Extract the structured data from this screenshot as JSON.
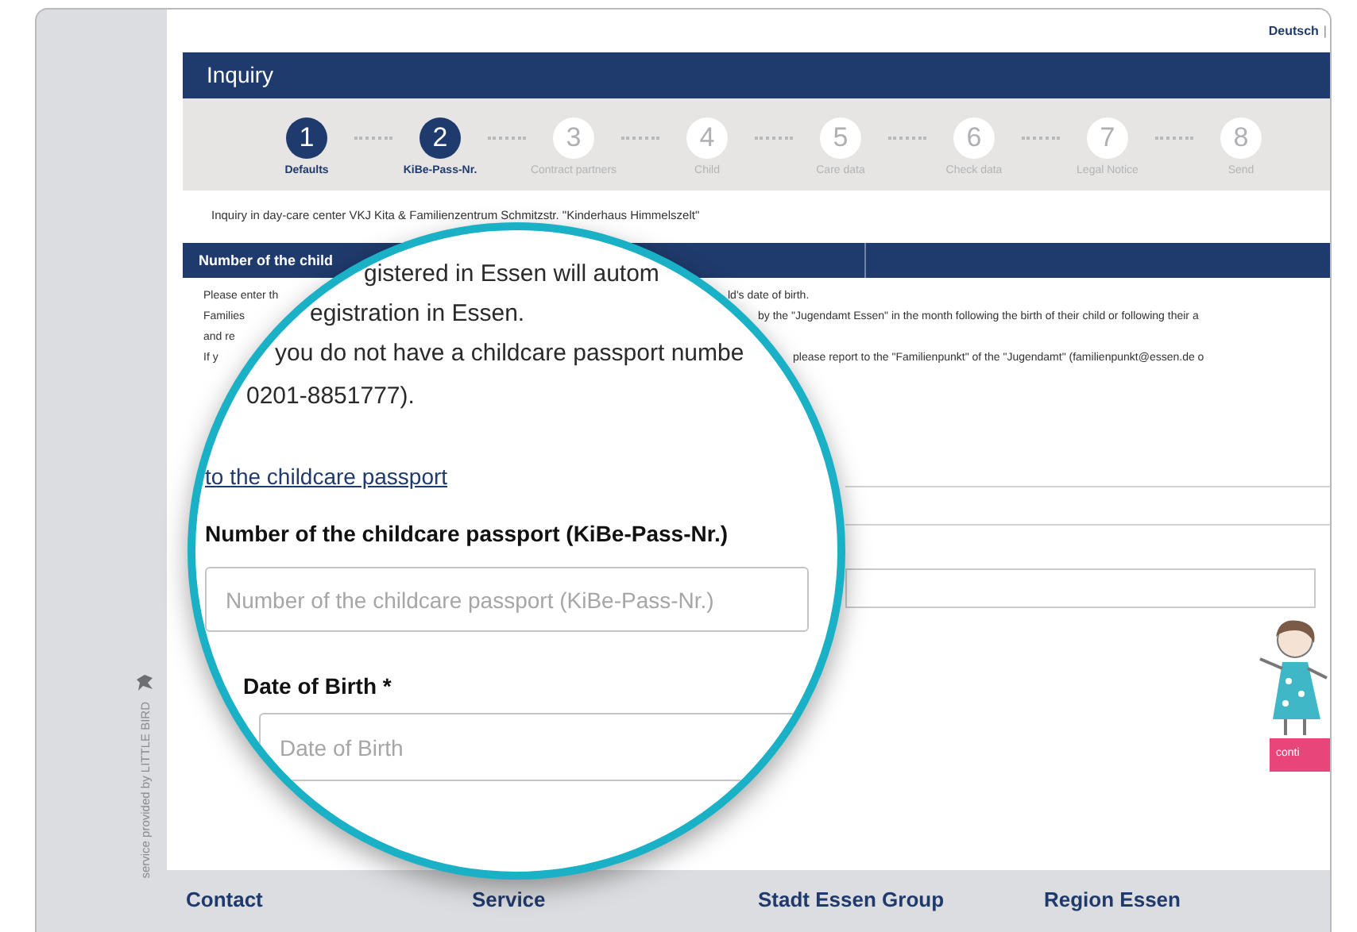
{
  "language_link": "Deutsch",
  "language_separator": "|",
  "header": {
    "title": "Inquiry"
  },
  "steps": [
    {
      "number": "1",
      "label": "Defaults",
      "done": true
    },
    {
      "number": "2",
      "label": "KiBe-Pass-Nr.",
      "done": true
    },
    {
      "number": "3",
      "label": "Contract partners",
      "done": false
    },
    {
      "number": "4",
      "label": "Child",
      "done": false
    },
    {
      "number": "5",
      "label": "Care data",
      "done": false
    },
    {
      "number": "6",
      "label": "Check data",
      "done": false
    },
    {
      "number": "7",
      "label": "Legal Notice",
      "done": false
    },
    {
      "number": "8",
      "label": "Send",
      "done": false
    }
  ],
  "facility_line": "Inquiry in day-care center VKJ Kita & Familienzentrum Schmitzstr. \"Kinderhaus Himmelszelt\"",
  "section": {
    "title": "Number of the child"
  },
  "background_text": [
    {
      "left": "Please enter th",
      "right": "ld's date of birth."
    },
    {
      "left": "Families",
      "right": "by the \"Jugendamt Essen\" in the month following the birth of their child or following their a"
    },
    {
      "left": "and re"
    },
    {
      "left": "If y",
      "right": "please report to the \"Familienpunkt\" of the \"Jugendamt\" (familienpunkt@essen.de o"
    }
  ],
  "magnifier": {
    "lines": [
      "gistered in Essen will autom",
      "egistration in Essen.",
      "you do not have a childcare passport numbe",
      "0201-8851777)."
    ],
    "link": "to the childcare passport",
    "fields": [
      {
        "label": "Number of the childcare passport (KiBe-Pass-Nr.)",
        "placeholder": "Number of the childcare passport (KiBe-Pass-Nr.)"
      },
      {
        "label": "Date of Birth *",
        "placeholder": "Date of Birth"
      }
    ]
  },
  "continue_button": "conti",
  "sidebar_credit": "service provided by LITTLE BIRD",
  "footer": {
    "columns": [
      "Contact",
      "Service",
      "Stadt Essen Group",
      "Region Essen"
    ]
  }
}
